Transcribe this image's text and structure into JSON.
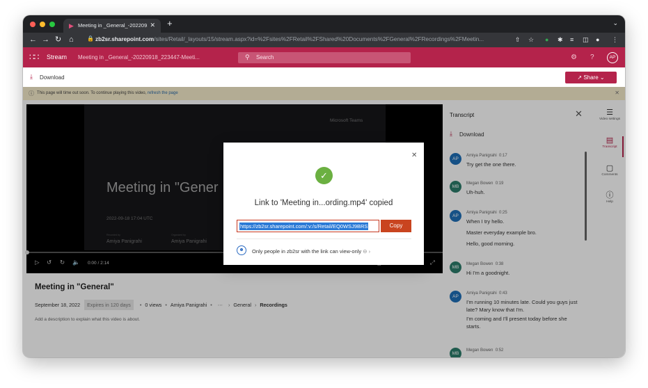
{
  "browser": {
    "tab_title": "Meeting in _General_-2022091",
    "url_host": "zb2sr.sharepoint.com",
    "url_path": "/sites/Retail/_layouts/15/stream.aspx?id=%2Fsites%2FRetail%2FShared%20Documents%2FGeneral%2FRecordings%2FMeetin..."
  },
  "app": {
    "name": "Stream",
    "doc_title": "Meeting in _General_-20220918_223447-Meeti...",
    "search_placeholder": "Search",
    "avatar_initials": "AP",
    "download_label": "Download",
    "share_label": "Share"
  },
  "notice": {
    "text": "This page will time out soon. To continue playing this video,",
    "link": "refresh the page"
  },
  "video": {
    "brand": "Microsoft Teams",
    "slide_title": "Meeting in \"Gener",
    "slide_date": "2022-09-18 17:04 UTC",
    "label_recorded": "Recorded by",
    "recorded_by": "Amiya Panigrahi",
    "label_organized": "Organized by",
    "organized_by": "Amiya Panigrahi",
    "time": "0:00 / 2:14",
    "progress_fraction": 0.0
  },
  "info": {
    "title": "Meeting in \"General\"",
    "date": "September 18, 2022",
    "expires": "Expires in 120 days",
    "views": "0 views",
    "author": "Amiya Panigrahi",
    "crumb_general": "General",
    "crumb_recordings": "Recordings",
    "description": "Add a description to explain what this video is about."
  },
  "transcript": {
    "title": "Transcript",
    "download_label": "Download",
    "entries": [
      {
        "initials": "AP",
        "color": "#1f6fb8",
        "speaker": "Amiya Panigrahi",
        "time": "0:17",
        "lines": [
          "Try get the one there."
        ]
      },
      {
        "initials": "MB",
        "color": "#2d7d6b",
        "speaker": "Megan Bowen",
        "time": "0:19",
        "lines": [
          "Uh-huh."
        ]
      },
      {
        "initials": "AP",
        "color": "#1f6fb8",
        "speaker": "Amiya Panigrahi",
        "time": "0:25",
        "lines": [
          "When I try hello.",
          "Master everyday example bro.",
          "Hello, good morning."
        ]
      },
      {
        "initials": "MB",
        "color": "#2d7d6b",
        "speaker": "Megan Bowen",
        "time": "0:38",
        "lines": [
          "Hi I'm a goodnight."
        ]
      },
      {
        "initials": "AP",
        "color": "#1f6fb8",
        "speaker": "Amiya Panigrahi",
        "time": "0:43",
        "lines": [
          "I'm running 10 minutes late. Could you guys just late? Mary know that I'm.",
          "I'm coming and I'll present today before she starts."
        ]
      },
      {
        "initials": "MB",
        "color": "#2d7d6b",
        "speaker": "Megan Bowen",
        "time": "0:52",
        "lines": []
      }
    ]
  },
  "rail": {
    "video_settings": "Video settings",
    "transcript": "Transcript",
    "comments": "Comments",
    "help": "Help"
  },
  "dialog": {
    "message": "Link to 'Meeting in...ording.mp4' copied",
    "link_value": "https://zb2sr.sharepoint.com/:v:/s/Retail/EQ0WSJ9BRS",
    "copy_label": "Copy",
    "permission_text": "Only people in zb2sr with the link can view-only"
  },
  "colors": {
    "brand": "#b4234b",
    "copy_button": "#c9441f",
    "success": "#6bb041"
  }
}
